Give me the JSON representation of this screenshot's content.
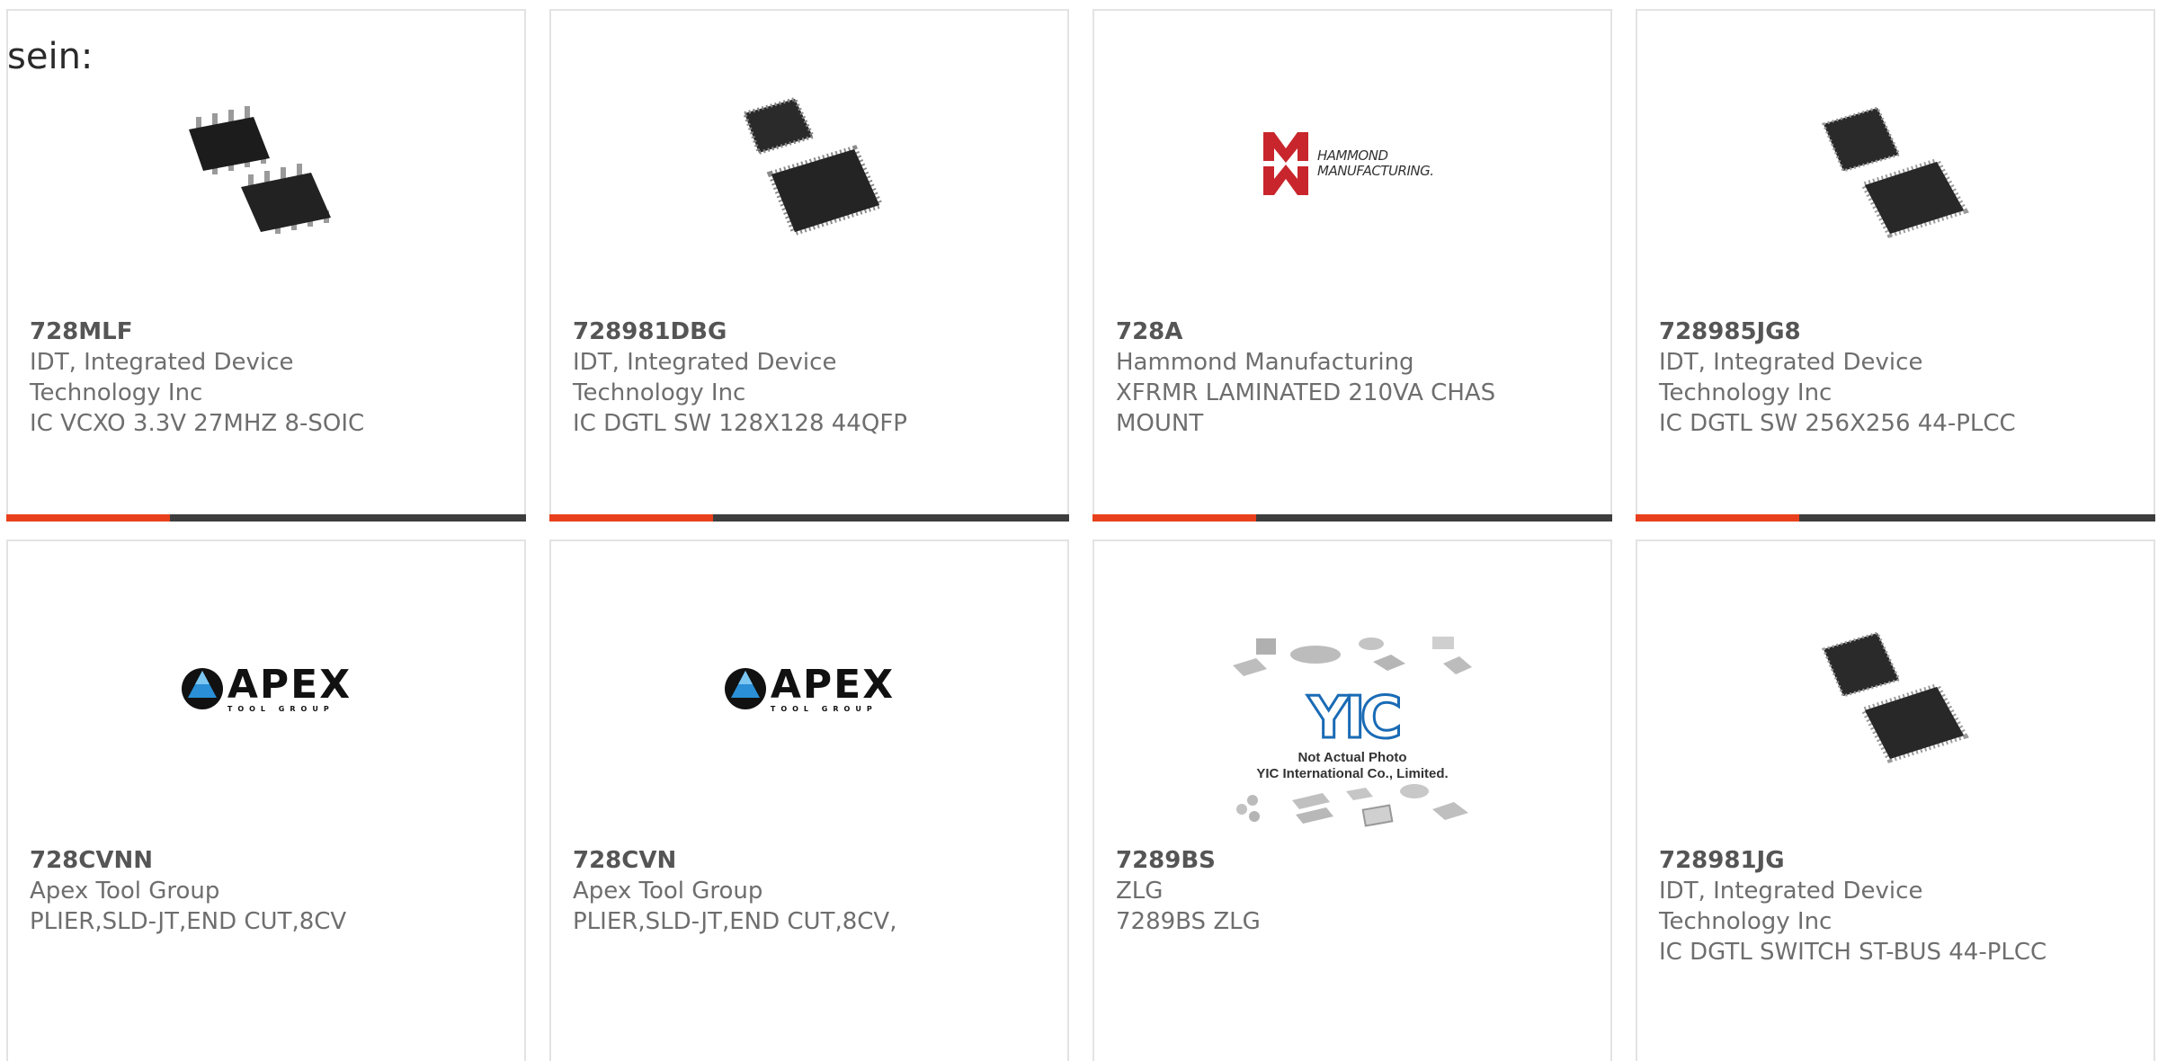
{
  "intro_text": "sein:",
  "colors": {
    "accent": "#e8401c",
    "bar": "#3d3d3d",
    "border": "#e3e3e3"
  },
  "products": [
    {
      "part_number": "728MLF",
      "manufacturer": "IDT, Integrated Device Technology Inc",
      "description": "IC VCXO 3.3V 27MHZ 8-SOIC",
      "image": "soic-8-chip-icon"
    },
    {
      "part_number": "728981DBG",
      "manufacturer": "IDT, Integrated Device Technology Inc",
      "description": "IC DGTL SW 128X128 44QFP",
      "image": "qfp-44-chip-icon"
    },
    {
      "part_number": "728A",
      "manufacturer": "Hammond Manufacturing",
      "description": "XFRMR LAMINATED 210VA CHAS MOUNT",
      "image": "hammond-logo",
      "logo_text": "HAMMOND MANUFACTURING."
    },
    {
      "part_number": "728985JG8",
      "manufacturer": "IDT, Integrated Device Technology Inc",
      "description": "IC DGTL SW 256X256 44-PLCC",
      "image": "plcc-44-chip-icon"
    },
    {
      "part_number": "728CVNN",
      "manufacturer": "Apex Tool Group",
      "description": "PLIER,SLD-JT,END CUT,8CV",
      "image": "apex-logo",
      "logo_text": "APEX",
      "logo_subtext": "TOOL GROUP"
    },
    {
      "part_number": "728CVN",
      "manufacturer": "Apex Tool Group",
      "description": "PLIER,SLD-JT,END CUT,8CV,",
      "image": "apex-logo",
      "logo_text": "APEX",
      "logo_subtext": "TOOL GROUP"
    },
    {
      "part_number": "7289BS",
      "manufacturer": "ZLG",
      "description": "7289BS ZLG",
      "image": "yic-placeholder",
      "logo_text": "YIC",
      "note_line1": "Not Actual Photo",
      "note_line2": "YIC International Co., Limited."
    },
    {
      "part_number": "728981JG",
      "manufacturer": "IDT, Integrated Device Technology Inc",
      "description": "IC DGTL SWITCH ST-BUS 44-PLCC",
      "image": "plcc-44-chip-icon"
    }
  ]
}
